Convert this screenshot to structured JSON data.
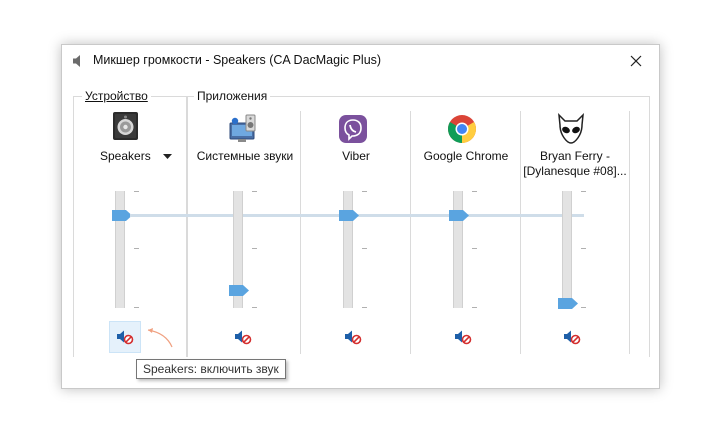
{
  "window": {
    "title": "Микшер громкости - Speakers (CA DacMagic Plus)",
    "icon": "speaker-icon",
    "close_icon": "close-icon"
  },
  "device_section": {
    "label": "Устройство",
    "device_name": "Speakers",
    "dropdown_icon": "chevron-down-icon",
    "volume_level": 0.8,
    "muted": true
  },
  "apps_section": {
    "label": "Приложения",
    "apps": [
      {
        "name": "Системные звуки",
        "icon": "system-sounds-icon",
        "volume_level": 0.18,
        "muted": true
      },
      {
        "name": "Viber",
        "icon": "viber-icon",
        "volume_level": 0.8,
        "muted": true
      },
      {
        "name": "Google Chrome",
        "icon": "chrome-icon",
        "volume_level": 0.8,
        "muted": true
      },
      {
        "name": "Bryan Ferry - [Dylanesque #08]...",
        "name_line1": "Bryan Ferry -",
        "name_line2": "[Dylanesque #08]...",
        "icon": "foobar-alien-icon",
        "volume_level": 0.05,
        "muted": true
      }
    ]
  },
  "tooltip": {
    "text": "Speakers: включить звук"
  },
  "colors": {
    "accent_thumb": "#5aa4e0",
    "mute_red": "#d32f2f",
    "speaker_blue": "#1e5fa8"
  }
}
